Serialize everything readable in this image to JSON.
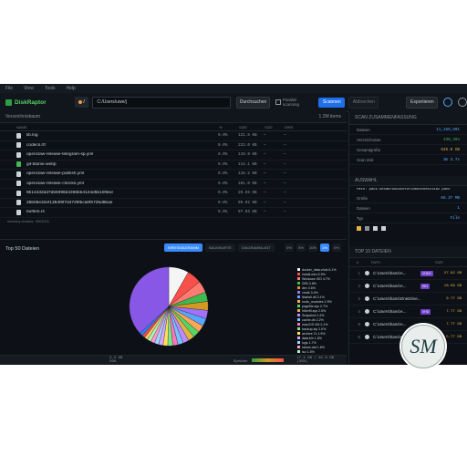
{
  "menu": [
    "File",
    "View",
    "Tools",
    "Help"
  ],
  "app": {
    "name": "DiskRaptor"
  },
  "toolbar": {
    "drive": "/",
    "path": "C:/Users/uwe/j",
    "browse_label": "Durchsuchen",
    "checkbox_label": "Parallel scanning",
    "scan_label": "Scannen",
    "stop_label": "Abbrechen",
    "export_label": "Exportieren"
  },
  "tree": {
    "title": "Verzeichnisbaum",
    "count": "1.2M items",
    "columns": [
      "NAME",
      "%",
      "SIZE",
      "SIZE",
      "DIRS"
    ],
    "rows": [
      {
        "name": "lib.log",
        "pct": "0.0%",
        "size": "121.5 KB",
        "sz2": "—",
        "dirs": "—",
        "img": false
      },
      {
        "name": "codecs.rtf",
        "pct": "0.0%",
        "size": "223.0 KB",
        "sz2": "—",
        "dirs": "—",
        "img": false
      },
      {
        "name": "openclaw-release-telegram-sp.yml",
        "pct": "0.0%",
        "size": "119.9 KB",
        "sz2": "—",
        "dirs": "—",
        "img": false
      },
      {
        "name": "git-blame.webp",
        "pct": "0.0%",
        "size": "114.1 KB",
        "sz2": "—",
        "dirs": "—",
        "img": true
      },
      {
        "name": "openclaw-release-publish.yml",
        "pct": "0.0%",
        "size": "118.2 KB",
        "sz2": "—",
        "dirs": "—",
        "img": false
      },
      {
        "name": "openclaw-release-checks.yml",
        "pct": "0.0%",
        "size": "101.0 KB",
        "sz2": "—",
        "dirs": "—",
        "img": false
      },
      {
        "name": "8b14432dd7db9398d4366bb4124d5b10f8ed",
        "pct": "0.0%",
        "size": "20.56 KB",
        "sz2": "—",
        "dirs": "—",
        "img": false
      },
      {
        "name": "28b06e32ef1384f9f7d4729fbca0f5725d9bae",
        "pct": "0.0%",
        "size": "90.92 KB",
        "sz2": "—",
        "dirs": "—",
        "img": false
      },
      {
        "name": "buffers.rs",
        "pct": "0.0%",
        "size": "97.93 KB",
        "sz2": "—",
        "dirs": "—",
        "img": false
      }
    ],
    "status": "memory chunks: 3/5/3/2/1"
  },
  "top50": {
    "title": "Top 50 Dateien",
    "tabs": [
      "KREISDIAGRAMM",
      "BAUMKARTE",
      "DIAGRAMMLAST"
    ],
    "pcts": [
      "0%",
      "5%",
      "10%",
      "1%",
      "0%"
    ]
  },
  "chart_data": {
    "type": "pie",
    "slices": [
      {
        "name": "docker_data.vhdx 8.1%",
        "value": 8.1,
        "color": "#f5f5f5"
      },
      {
        "name": "install.wim 5.9%",
        "value": 5.9,
        "color": "#f85149"
      },
      {
        "name": "Windows ISO 4.7%",
        "value": 4.7,
        "color": "#ff7b72"
      },
      {
        "name": "2KB 3.8%",
        "value": 3.8,
        "color": "#3fb950"
      },
      {
        "name": "dev 3.6%",
        "value": 3.6,
        "color": "#d29922"
      },
      {
        "name": "vmdk 3.4%",
        "value": 3.4,
        "color": "#a371f7"
      },
      {
        "name": "libshell.dll 3.1%",
        "value": 3.1,
        "color": "#58a6ff"
      },
      {
        "name": "node_modules 2.9%",
        "value": 2.9,
        "color": "#ffa657"
      },
      {
        "name": "pagefile.sys 2.7%",
        "value": 2.7,
        "color": "#56d364"
      },
      {
        "name": "hiberfil.sys 2.5%",
        "value": 2.5,
        "color": "#e3b341"
      },
      {
        "name": "Snapshot 2.4%",
        "value": 2.4,
        "color": "#bc8cff"
      },
      {
        "name": "cache.db 2.2%",
        "value": 2.2,
        "color": "#79c0ff"
      },
      {
        "name": "mac/OS VM 2.1%",
        "value": 2.1,
        "color": "#f778ba"
      },
      {
        "name": "backup.zip 2.0%",
        "value": 2.0,
        "color": "#7ee787"
      },
      {
        "name": "archive.7z 1.9%",
        "value": 1.9,
        "color": "#ffdf5d"
      },
      {
        "name": "data.bin 1.8%",
        "value": 1.8,
        "color": "#d2a8ff"
      },
      {
        "name": "logs 1.7%",
        "value": 1.7,
        "color": "#a5d6ff"
      },
      {
        "name": "steam.dat 1.6%",
        "value": 1.6,
        "color": "#ff9bce"
      },
      {
        "name": "iso 1.5%",
        "value": 1.5,
        "color": "#aff5b4"
      },
      {
        "name": "textures 1.4%",
        "value": 1.4,
        "color": "#f2cc60"
      },
      {
        "name": "mail.pst 1.3%",
        "value": 1.3,
        "color": "#ea4a5a"
      },
      {
        "name": "video.mkv 1.2%",
        "value": 1.2,
        "color": "#2188ff"
      },
      {
        "name": "... 10 more",
        "value": 36.2,
        "color": "#8957e5"
      }
    ]
  },
  "bottombar": {
    "left": "2.4 GB  29%",
    "legend": "Speicher",
    "right": "17.1 GB / 91.0 GB (35%)"
  },
  "summary": {
    "title": "SCAN ZUSAMMENFASSUNG",
    "rows": [
      {
        "k": "Dateien",
        "v": "11,280,001",
        "cls": ""
      },
      {
        "k": "Verzeichnisse",
        "v": "330,394",
        "cls": "green"
      },
      {
        "k": "Gesamtgröße",
        "v": "645.9 GB",
        "cls": "ora"
      },
      {
        "k": "Scan Zeit",
        "v": "3m 3.7s",
        "cls": ""
      }
    ]
  },
  "selected": {
    "title": "AUSWAHL",
    "path": "Path: pack-8e5a8f9d99c0f9f3d6bdc0e0214a2 pack",
    "rows": [
      {
        "k": "Größe",
        "v": "66.37 MB",
        "cls": ""
      },
      {
        "k": "Dateien",
        "v": "1",
        "cls": ""
      },
      {
        "k": "Typ",
        "v": "File",
        "cls": ""
      }
    ]
  },
  "top10": {
    "title": "TOP 10 DATEIEN",
    "columns": [
      "#",
      "PATH",
      "SIZE"
    ],
    "rows": [
      {
        "n": "1",
        "p": "C:\\Users\\hans\\A...",
        "badge": "VHDX",
        "s": "27.82 GB"
      },
      {
        "n": "2",
        "p": "C:\\Users\\hans\\A...",
        "badge": "ISO",
        "s": "18.88 GB"
      },
      {
        "n": "3",
        "p": "C:\\Users\\hans\\OneDrive...",
        "badge": "",
        "s": "9.77 GB"
      },
      {
        "n": "4",
        "p": "C:\\Users\\hans\\A...",
        "badge": "VHD",
        "s": "7.77 GB"
      },
      {
        "n": "5",
        "p": "C:\\Users\\hans\\A...",
        "badge": "",
        "s": "7.77 GB"
      },
      {
        "n": "6",
        "p": "C:\\Users\\hans\\A...",
        "badge": "",
        "s": "5.77 GB"
      }
    ]
  }
}
